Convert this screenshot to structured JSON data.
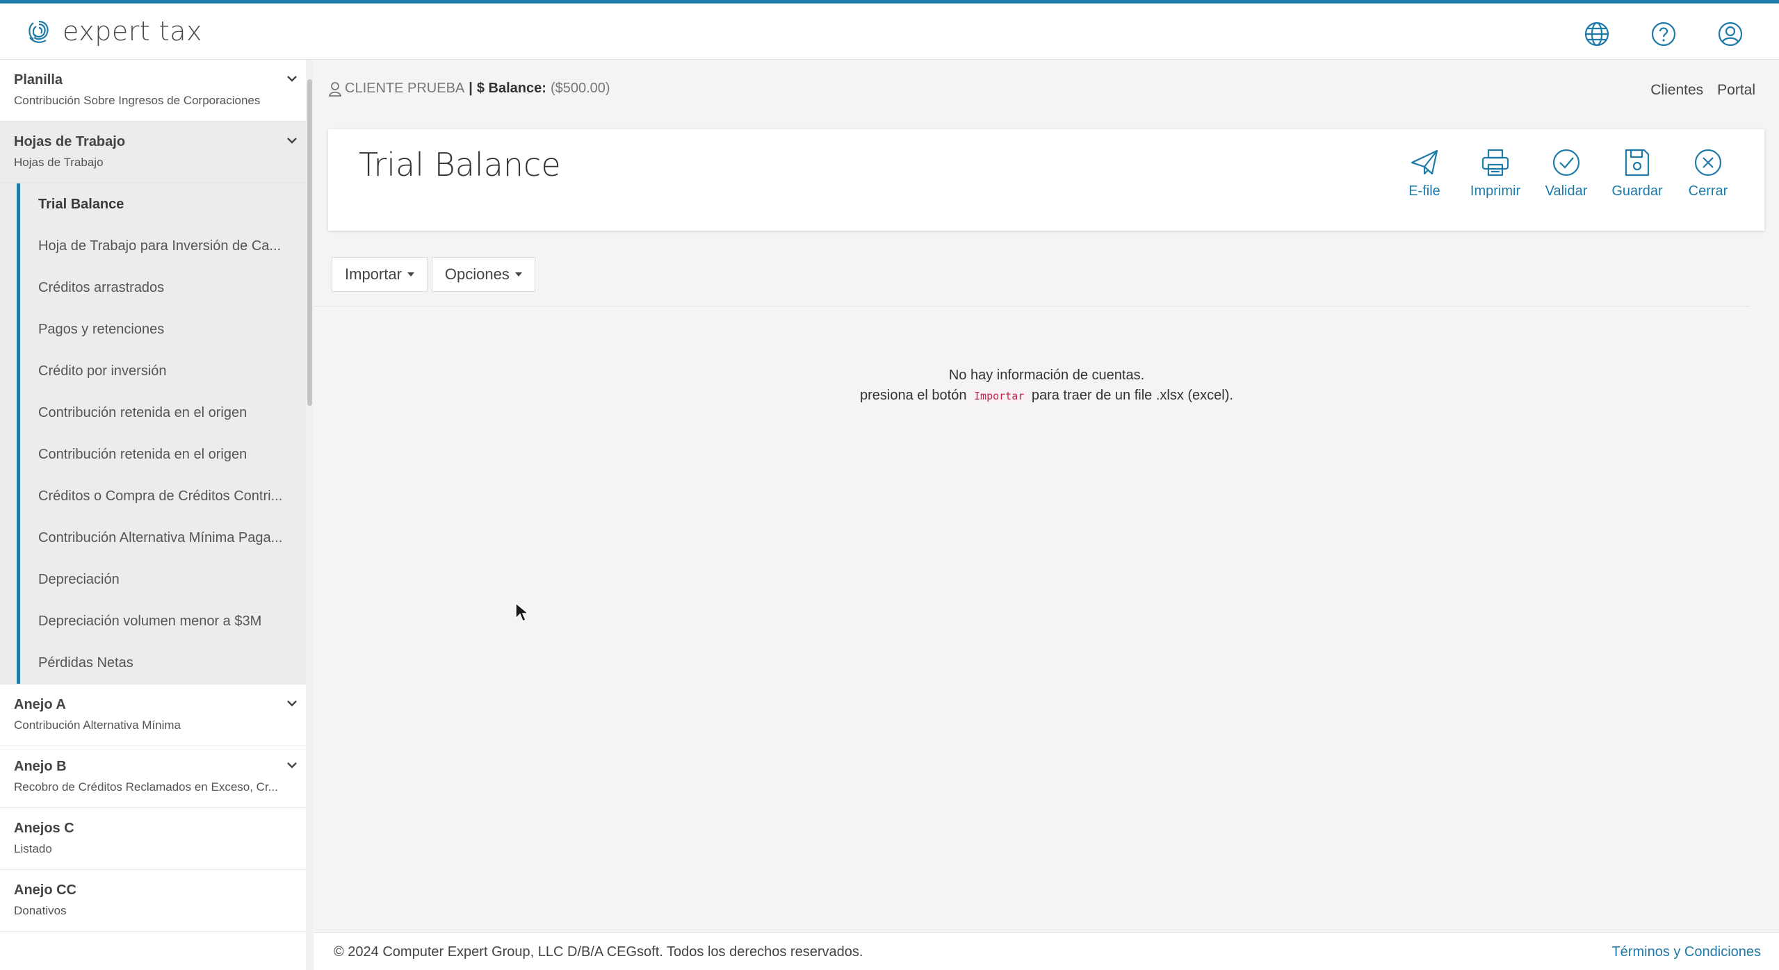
{
  "app": {
    "brand": "expert tax",
    "accent_color": "#1f7aa8",
    "top_icons": [
      "globe-icon",
      "help-icon",
      "user-account-icon"
    ]
  },
  "sidebar": {
    "sections": [
      {
        "title": "Planilla",
        "subtitle": "Contribución Sobre Ingresos de Corporaciones",
        "expandable": true
      },
      {
        "title": "Hojas de Trabajo",
        "subtitle": "Hojas de Trabajo",
        "expandable": true,
        "open": true,
        "items": [
          {
            "label": "Trial Balance",
            "active": true
          },
          {
            "label": "Hoja de Trabajo para Inversión de Ca..."
          },
          {
            "label": "Créditos arrastrados"
          },
          {
            "label": "Pagos y retenciones"
          },
          {
            "label": "Crédito por inversión"
          },
          {
            "label": "Contribución retenida en el origen"
          },
          {
            "label": "Contribución retenida en el origen"
          },
          {
            "label": "Créditos o Compra de Créditos Contri..."
          },
          {
            "label": "Contribución Alternativa Mínima Paga..."
          },
          {
            "label": "Depreciación"
          },
          {
            "label": "Depreciación volumen menor a $3M"
          },
          {
            "label": "Pérdidas Netas"
          }
        ]
      },
      {
        "title": "Anejo A",
        "subtitle": "Contribución Alternativa Mínima",
        "expandable": true
      },
      {
        "title": "Anejo B",
        "subtitle": "Recobro de Créditos Reclamados en Exceso, Cr...",
        "expandable": true
      },
      {
        "title": "Anejos C",
        "subtitle": "Listado",
        "expandable": false
      },
      {
        "title": "Anejo CC",
        "subtitle": "Donativos",
        "expandable": false
      }
    ]
  },
  "client_bar": {
    "client_name": "CLIENTE PRUEBA",
    "separator": "|",
    "balance_label": "$ Balance:",
    "balance_value": "($500.00)"
  },
  "top_links": {
    "clients": "Clientes",
    "portal": "Portal"
  },
  "page": {
    "title": "Trial Balance",
    "actions": [
      {
        "label": "E-file",
        "icon": "send-icon"
      },
      {
        "label": "Imprimir",
        "icon": "print-icon"
      },
      {
        "label": "Validar",
        "icon": "check-circle-icon"
      },
      {
        "label": "Guardar",
        "icon": "save-icon"
      },
      {
        "label": "Cerrar",
        "icon": "close-circle-icon"
      }
    ]
  },
  "toolbar": {
    "import_label": "Importar",
    "options_label": "Opciones"
  },
  "empty_state": {
    "line1": "No hay información de cuentas.",
    "line2_before": "presiona el botón",
    "line2_code": "Importar",
    "line2_after": "para traer de un file .xlsx (excel)."
  },
  "footer": {
    "copyright": "© 2024 Computer Expert Group, LLC D/B/A CEGsoft. Todos los derechos reservados.",
    "terms": "Términos y Condiciones"
  }
}
